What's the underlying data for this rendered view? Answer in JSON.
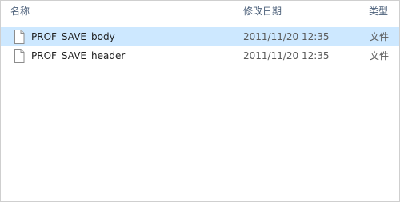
{
  "columns": {
    "name": "名称",
    "date": "修改日期",
    "type": "类型"
  },
  "files": [
    {
      "name": "PROF_SAVE_body",
      "modified": "2011/11/20 12:35",
      "type": "文件",
      "selected": true,
      "icon": "file-icon"
    },
    {
      "name": "PROF_SAVE_header",
      "modified": "2011/11/20 12:35",
      "type": "文件",
      "selected": false,
      "icon": "file-icon"
    }
  ],
  "colors": {
    "selection": "#cde8ff",
    "header_text": "#4c607a"
  }
}
